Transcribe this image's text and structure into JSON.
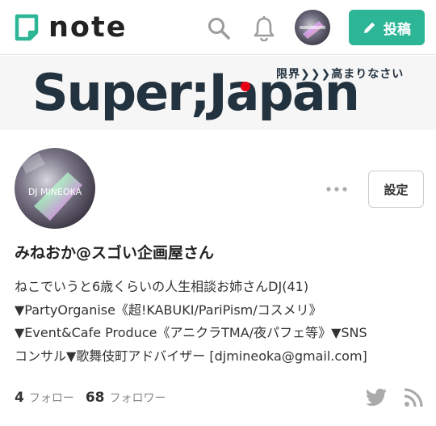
{
  "header": {
    "logo_text": "note",
    "post_button_label": "投稿"
  },
  "banner": {
    "title": "Super;Japan",
    "subtitle": "限界❯❯❯高まりなさい"
  },
  "profile": {
    "avatar_text": "DJ MINEOKA",
    "name": "みねおか@スゴい企画屋さん",
    "settings_label": "設定",
    "bio_lines": [
      "ねこでいうと6歳くらいの人生相談お姉さんDJ(41)",
      "▼PartyOrganise《超!KABUKI/PariPism/コスメリ》",
      "▼Event&Cafe Produce《アニクラTMA/夜パフェ等》▼SNS",
      "コンサル▼歌舞伎町アドバイザー [djmineoka@gmail.com]"
    ],
    "follow_count": "4",
    "follow_label": "フォロー",
    "follower_count": "68",
    "follower_label": "フォロワー"
  },
  "colors": {
    "brand": "#2cb696",
    "banner_text": "#23323f",
    "banner_accent": "#e60012"
  },
  "icons": [
    "note-logo-icon",
    "search-icon",
    "bell-icon",
    "pencil-icon",
    "more-icon",
    "twitter-icon",
    "rss-icon"
  ]
}
